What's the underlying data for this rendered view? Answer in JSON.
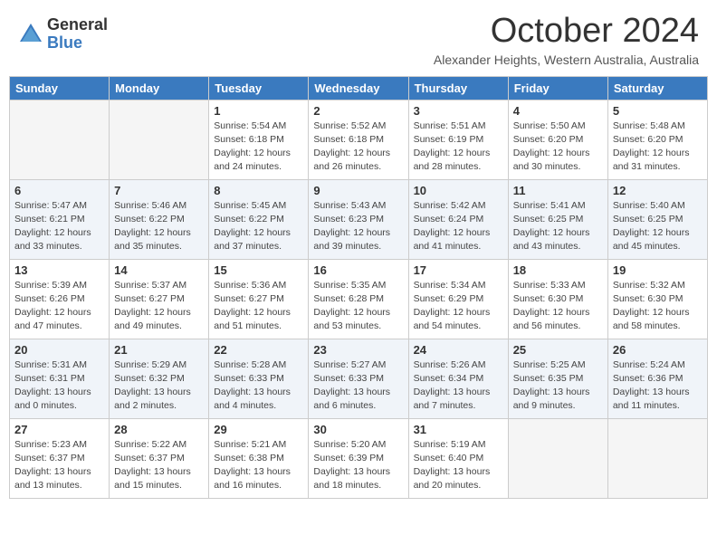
{
  "header": {
    "logo_general": "General",
    "logo_blue": "Blue",
    "month_title": "October 2024",
    "subtitle": "Alexander Heights, Western Australia, Australia"
  },
  "weekdays": [
    "Sunday",
    "Monday",
    "Tuesday",
    "Wednesday",
    "Thursday",
    "Friday",
    "Saturday"
  ],
  "weeks": [
    [
      {
        "day": "",
        "info": ""
      },
      {
        "day": "",
        "info": ""
      },
      {
        "day": "1",
        "info": "Sunrise: 5:54 AM\nSunset: 6:18 PM\nDaylight: 12 hours and 24 minutes."
      },
      {
        "day": "2",
        "info": "Sunrise: 5:52 AM\nSunset: 6:18 PM\nDaylight: 12 hours and 26 minutes."
      },
      {
        "day": "3",
        "info": "Sunrise: 5:51 AM\nSunset: 6:19 PM\nDaylight: 12 hours and 28 minutes."
      },
      {
        "day": "4",
        "info": "Sunrise: 5:50 AM\nSunset: 6:20 PM\nDaylight: 12 hours and 30 minutes."
      },
      {
        "day": "5",
        "info": "Sunrise: 5:48 AM\nSunset: 6:20 PM\nDaylight: 12 hours and 31 minutes."
      }
    ],
    [
      {
        "day": "6",
        "info": "Sunrise: 5:47 AM\nSunset: 6:21 PM\nDaylight: 12 hours and 33 minutes."
      },
      {
        "day": "7",
        "info": "Sunrise: 5:46 AM\nSunset: 6:22 PM\nDaylight: 12 hours and 35 minutes."
      },
      {
        "day": "8",
        "info": "Sunrise: 5:45 AM\nSunset: 6:22 PM\nDaylight: 12 hours and 37 minutes."
      },
      {
        "day": "9",
        "info": "Sunrise: 5:43 AM\nSunset: 6:23 PM\nDaylight: 12 hours and 39 minutes."
      },
      {
        "day": "10",
        "info": "Sunrise: 5:42 AM\nSunset: 6:24 PM\nDaylight: 12 hours and 41 minutes."
      },
      {
        "day": "11",
        "info": "Sunrise: 5:41 AM\nSunset: 6:25 PM\nDaylight: 12 hours and 43 minutes."
      },
      {
        "day": "12",
        "info": "Sunrise: 5:40 AM\nSunset: 6:25 PM\nDaylight: 12 hours and 45 minutes."
      }
    ],
    [
      {
        "day": "13",
        "info": "Sunrise: 5:39 AM\nSunset: 6:26 PM\nDaylight: 12 hours and 47 minutes."
      },
      {
        "day": "14",
        "info": "Sunrise: 5:37 AM\nSunset: 6:27 PM\nDaylight: 12 hours and 49 minutes."
      },
      {
        "day": "15",
        "info": "Sunrise: 5:36 AM\nSunset: 6:27 PM\nDaylight: 12 hours and 51 minutes."
      },
      {
        "day": "16",
        "info": "Sunrise: 5:35 AM\nSunset: 6:28 PM\nDaylight: 12 hours and 53 minutes."
      },
      {
        "day": "17",
        "info": "Sunrise: 5:34 AM\nSunset: 6:29 PM\nDaylight: 12 hours and 54 minutes."
      },
      {
        "day": "18",
        "info": "Sunrise: 5:33 AM\nSunset: 6:30 PM\nDaylight: 12 hours and 56 minutes."
      },
      {
        "day": "19",
        "info": "Sunrise: 5:32 AM\nSunset: 6:30 PM\nDaylight: 12 hours and 58 minutes."
      }
    ],
    [
      {
        "day": "20",
        "info": "Sunrise: 5:31 AM\nSunset: 6:31 PM\nDaylight: 13 hours and 0 minutes."
      },
      {
        "day": "21",
        "info": "Sunrise: 5:29 AM\nSunset: 6:32 PM\nDaylight: 13 hours and 2 minutes."
      },
      {
        "day": "22",
        "info": "Sunrise: 5:28 AM\nSunset: 6:33 PM\nDaylight: 13 hours and 4 minutes."
      },
      {
        "day": "23",
        "info": "Sunrise: 5:27 AM\nSunset: 6:33 PM\nDaylight: 13 hours and 6 minutes."
      },
      {
        "day": "24",
        "info": "Sunrise: 5:26 AM\nSunset: 6:34 PM\nDaylight: 13 hours and 7 minutes."
      },
      {
        "day": "25",
        "info": "Sunrise: 5:25 AM\nSunset: 6:35 PM\nDaylight: 13 hours and 9 minutes."
      },
      {
        "day": "26",
        "info": "Sunrise: 5:24 AM\nSunset: 6:36 PM\nDaylight: 13 hours and 11 minutes."
      }
    ],
    [
      {
        "day": "27",
        "info": "Sunrise: 5:23 AM\nSunset: 6:37 PM\nDaylight: 13 hours and 13 minutes."
      },
      {
        "day": "28",
        "info": "Sunrise: 5:22 AM\nSunset: 6:37 PM\nDaylight: 13 hours and 15 minutes."
      },
      {
        "day": "29",
        "info": "Sunrise: 5:21 AM\nSunset: 6:38 PM\nDaylight: 13 hours and 16 minutes."
      },
      {
        "day": "30",
        "info": "Sunrise: 5:20 AM\nSunset: 6:39 PM\nDaylight: 13 hours and 18 minutes."
      },
      {
        "day": "31",
        "info": "Sunrise: 5:19 AM\nSunset: 6:40 PM\nDaylight: 13 hours and 20 minutes."
      },
      {
        "day": "",
        "info": ""
      },
      {
        "day": "",
        "info": ""
      }
    ]
  ]
}
